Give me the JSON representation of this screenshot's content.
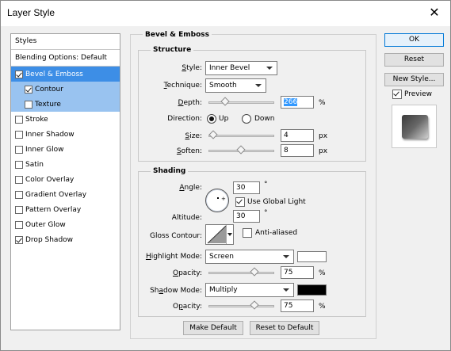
{
  "window": {
    "title": "Layer Style",
    "close_glyph": "✕"
  },
  "left_panel": {
    "header": "Styles",
    "blending": "Blending Options: Default",
    "items": [
      {
        "label": "Bevel & Emboss",
        "checked": true,
        "state": "selected"
      },
      {
        "label": "Contour",
        "checked": true,
        "state": "sub-selected"
      },
      {
        "label": "Texture",
        "checked": false,
        "state": "sub-selected"
      },
      {
        "label": "Stroke",
        "checked": false
      },
      {
        "label": "Inner Shadow",
        "checked": false
      },
      {
        "label": "Inner Glow",
        "checked": false
      },
      {
        "label": "Satin",
        "checked": false
      },
      {
        "label": "Color Overlay",
        "checked": false
      },
      {
        "label": "Gradient Overlay",
        "checked": false
      },
      {
        "label": "Pattern Overlay",
        "checked": false
      },
      {
        "label": "Outer Glow",
        "checked": false
      },
      {
        "label": "Drop Shadow",
        "checked": true
      }
    ]
  },
  "bevel": {
    "title": "Bevel & Emboss",
    "structure": {
      "title": "Structure",
      "style_label": "Style:",
      "style_value": "Inner Bevel",
      "technique_label": "Technique:",
      "technique_value": "Smooth",
      "depth_label": "Depth:",
      "depth_value": "266",
      "depth_unit": "%",
      "depth_slider": 0.22,
      "direction_label": "Direction:",
      "dir_up": "Up",
      "dir_down": "Down",
      "direction_value": "Up",
      "size_label": "Size:",
      "size_value": "4",
      "size_unit": "px",
      "size_slider": 0.02,
      "soften_label": "Soften:",
      "soften_value": "8",
      "soften_unit": "px",
      "soften_slider": 0.5
    },
    "shading": {
      "title": "Shading",
      "angle_label": "Angle:",
      "angle_value": "30",
      "degree": "°",
      "global_light_label": "Use Global Light",
      "global_light": true,
      "altitude_label": "Altitude:",
      "altitude_value": "30",
      "gloss_label": "Gloss Contour:",
      "anti_aliased_label": "Anti-aliased",
      "anti_aliased": false,
      "highlight_label": "Highlight Mode:",
      "highlight_value": "Screen",
      "highlight_color": "#ffffff",
      "h_opacity_label": "Opacity:",
      "h_opacity_value": "75",
      "h_opacity_unit": "%",
      "h_opacity_slider": 0.75,
      "shadow_label": "Shadow Mode:",
      "shadow_value": "Multiply",
      "shadow_color": "#000000",
      "s_opacity_label": "Opacity:",
      "s_opacity_value": "75",
      "s_opacity_unit": "%",
      "s_opacity_slider": 0.75
    },
    "make_default": "Make Default",
    "reset_default": "Reset to Default"
  },
  "right": {
    "ok": "OK",
    "reset": "Reset",
    "new_style": "New Style...",
    "preview_label": "Preview",
    "preview": true
  }
}
